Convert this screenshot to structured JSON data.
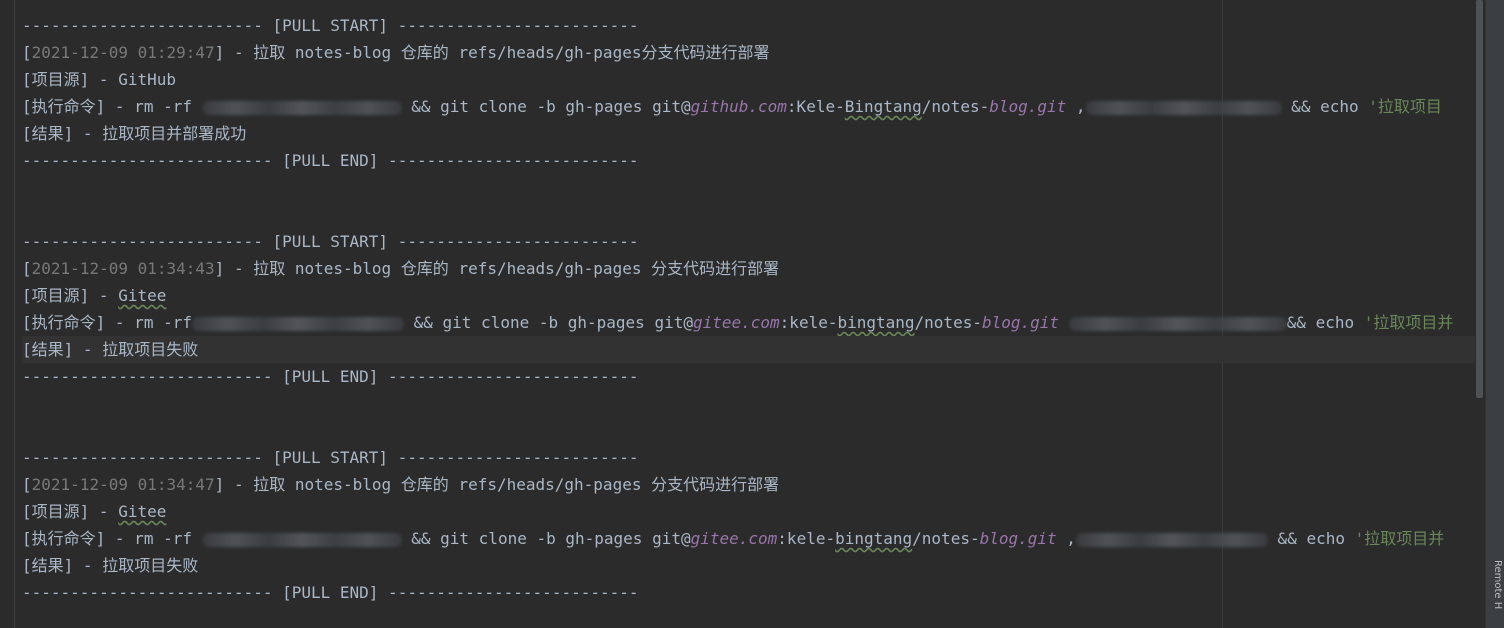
{
  "rule_char": "-",
  "blocks": [
    {
      "start_marker": "[PULL START]",
      "end_marker": "[PULL END]",
      "timestamp": "2021-12-09 01:29:47",
      "pull_text": " - 拉取 notes-blog 仓库的 refs/heads/gh-pages分支代码进行部署",
      "source_label": "[项目源]",
      "source_sep": " - ",
      "source_value": "GitHub",
      "cmd_label": "[执行命令]",
      "cmd_prefix": " - rm -rf ",
      "cmd_clone": " && git clone -b gh-pages git@",
      "cmd_host": "github.com",
      "cmd_owner_pre": ":Kele-",
      "cmd_owner_wavy": "Bingtang",
      "cmd_repo_pre": "/notes-",
      "cmd_repo_it": "blog.git",
      "cmd_sep": " ,",
      "cmd_echo": " && echo ",
      "cmd_echo_str": "'拉取项目",
      "result_label": "[结果]",
      "result_sep": " - ",
      "result_value": "拉取项目并部署成功"
    },
    {
      "start_marker": "[PULL START]",
      "end_marker": "[PULL END]",
      "timestamp": "2021-12-09 01:34:43",
      "pull_text": " - 拉取 notes-blog 仓库的 refs/heads/gh-pages 分支代码进行部署",
      "source_label": "[项目源]",
      "source_sep": " - ",
      "source_value": "Gitee",
      "cmd_label": "[执行命令]",
      "cmd_prefix": " - rm -rf",
      "cmd_clone": " && git clone -b gh-pages git@",
      "cmd_host": "gitee.com",
      "cmd_owner_pre": ":kele-",
      "cmd_owner_wavy": "bingtang",
      "cmd_repo_pre": "/notes-",
      "cmd_repo_it": "blog.git",
      "cmd_sep": " ",
      "cmd_echo": "&& echo ",
      "cmd_echo_str": "'拉取项目并",
      "result_label": "[结果]",
      "result_sep": " - ",
      "result_value": "拉取项目失败"
    },
    {
      "start_marker": "[PULL START]",
      "end_marker": "[PULL END]",
      "timestamp": "2021-12-09 01:34:47",
      "pull_text": " - 拉取 notes-blog 仓库的 refs/heads/gh-pages 分支代码进行部署",
      "source_label": "[项目源]",
      "source_sep": " - ",
      "source_value": "Gitee",
      "cmd_label": "[执行命令]",
      "cmd_prefix": " - rm -rf ",
      "cmd_clone": " && git clone -b gh-pages git@",
      "cmd_host": "gitee.com",
      "cmd_owner_pre": ":kele-",
      "cmd_owner_wavy": "bingtang",
      "cmd_repo_pre": "/notes-",
      "cmd_repo_it": "blog.git",
      "cmd_sep": " ,",
      "cmd_echo": " && echo ",
      "cmd_echo_str": "'拉取项目并",
      "result_label": "[结果]",
      "result_sep": " - ",
      "result_value": "拉取项目失败"
    }
  ],
  "side_panel": {
    "label": "Remote H"
  },
  "colors": {
    "background": "#2b2b2b",
    "text": "#a9b7c6",
    "timestamp": "#787878",
    "string": "#6a8759",
    "italic_host": "#9876aa",
    "current_line": "#323232"
  }
}
